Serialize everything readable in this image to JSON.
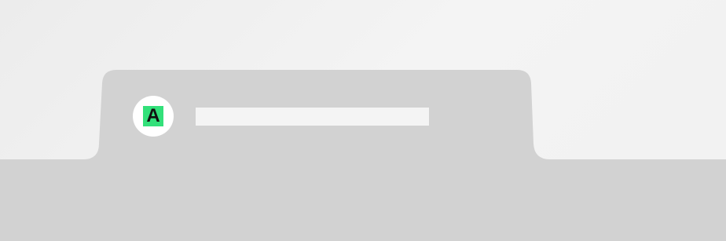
{
  "tab": {
    "favicon_letter": "A",
    "title": ""
  },
  "colors": {
    "background": "#f1f1f1",
    "tab_fill": "#d2d2d2",
    "favicon_bg": "#ffffff",
    "favicon_accent": "#33e07a",
    "title_placeholder": "#f4f4f4"
  },
  "icons": {
    "favicon": "letter-a-favicon-icon"
  }
}
